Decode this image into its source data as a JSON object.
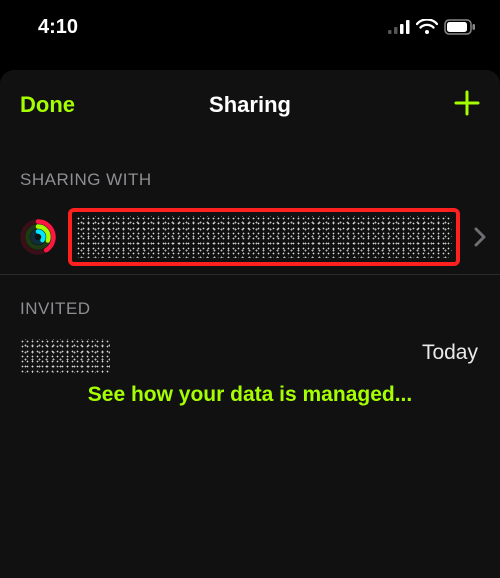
{
  "status": {
    "time": "4:10"
  },
  "nav": {
    "done": "Done",
    "title": "Sharing"
  },
  "sections": {
    "sharing_with_header": "SHARING WITH",
    "invited_header": "INVITED"
  },
  "sharing_with": {
    "name_obscured": true
  },
  "invited": {
    "name_obscured": true,
    "date": "Today"
  },
  "footer": {
    "data_link": "See how your data is managed..."
  },
  "colors": {
    "accent": "#A6FF00"
  }
}
